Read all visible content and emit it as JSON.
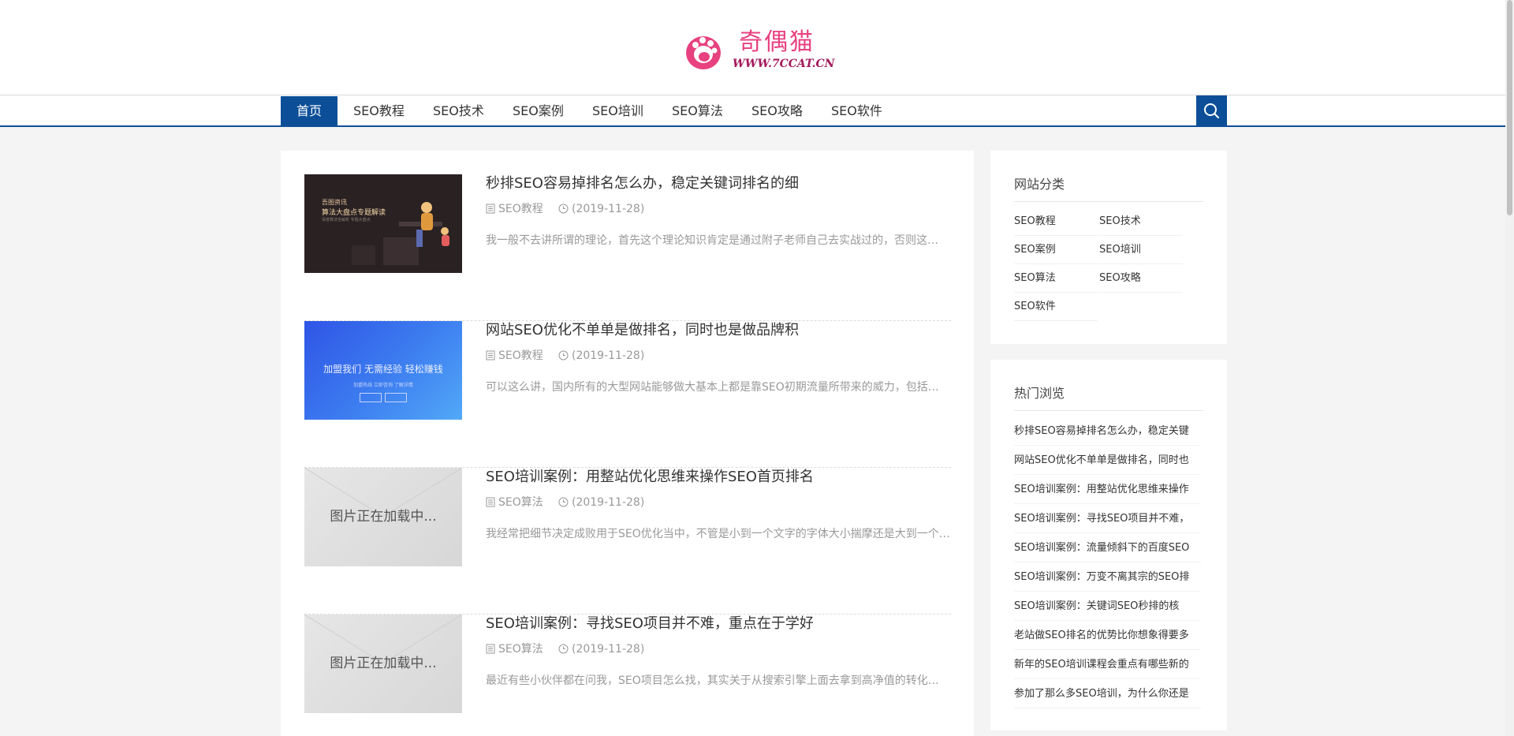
{
  "logo": {
    "cn": "奇偶猫",
    "url": "WWW.7CCAT.CN",
    "icon": "cat-paw-icon"
  },
  "nav": {
    "items": [
      "首页",
      "SEO教程",
      "SEO技术",
      "SEO案例",
      "SEO培训",
      "SEO算法",
      "SEO攻略",
      "SEO软件"
    ],
    "active_index": 0,
    "search_icon": "search-icon"
  },
  "posts": [
    {
      "title": "秒排SEO容易掉排名怎么办，稳定关键词排名的细",
      "category": "SEO教程",
      "date": "(2019-11-28)",
      "excerpt": "我一般不去讲所谓的理论，首先这个理论知识肯定是通过附子老师自己去实战过的，否则这…",
      "thumb": {
        "style": "dark",
        "line1": "吾图资讯",
        "line2": "算法大盘点专题解读",
        "line3": "百度算法全解析 专题大盘点"
      }
    },
    {
      "title": "网站SEO优化不单单是做排名，同时也是做品牌积",
      "category": "SEO教程",
      "date": "(2019-11-28)",
      "excerpt": "可以这么讲，国内所有的大型网站能够做大基本上都是靠SEO初期流量所带来的威力，包括…",
      "thumb": {
        "style": "blue",
        "line1": "加盟我们 无需经验 轻松赚钱",
        "line2": "加盟热线 立即咨询 了解详情"
      }
    },
    {
      "title": "SEO培训案例：用整站优化思维来操作SEO首页排名",
      "category": "SEO算法",
      "date": "(2019-11-28)",
      "excerpt": "我经常把细节决定成败用于SEO优化当中，不管是小到一个文字的字体大小揣摩还是大到一个…",
      "thumb": {
        "style": "gray",
        "placeholder": "图片正在加载中..."
      }
    },
    {
      "title": "SEO培训案例：寻找SEO项目并不难，重点在于学好",
      "category": "SEO算法",
      "date": "(2019-11-28)",
      "excerpt": "最近有些小伙伴都在问我，SEO项目怎么找，其实关于从搜索引擎上面去拿到高净值的转化…",
      "thumb": {
        "style": "gray",
        "placeholder": "图片正在加载中..."
      }
    }
  ],
  "sidebar": {
    "categories": {
      "title": "网站分类",
      "items": [
        "SEO教程",
        "SEO技术",
        "SEO案例",
        "SEO培训",
        "SEO算法",
        "SEO攻略",
        "SEO软件"
      ]
    },
    "hot": {
      "title": "热门浏览",
      "items": [
        "秒排SEO容易掉排名怎么办，稳定关键",
        "网站SEO优化不单单是做排名，同时也",
        "SEO培训案例：用整站优化思维来操作",
        "SEO培训案例：寻找SEO项目并不难，",
        "SEO培训案例：流量倾斜下的百度SEO",
        "SEO培训案例：万变不离其宗的SEO排",
        "SEO培训案例：关键词SEO秒排的核",
        "老站做SEO排名的优势比你想象得要多",
        "新年的SEO培训课程会重点有哪些新的",
        "参加了那么多SEO培训，为什么你还是"
      ]
    }
  },
  "colors": {
    "primary": "#0c4f98",
    "logo_pink": "#e8417f"
  }
}
